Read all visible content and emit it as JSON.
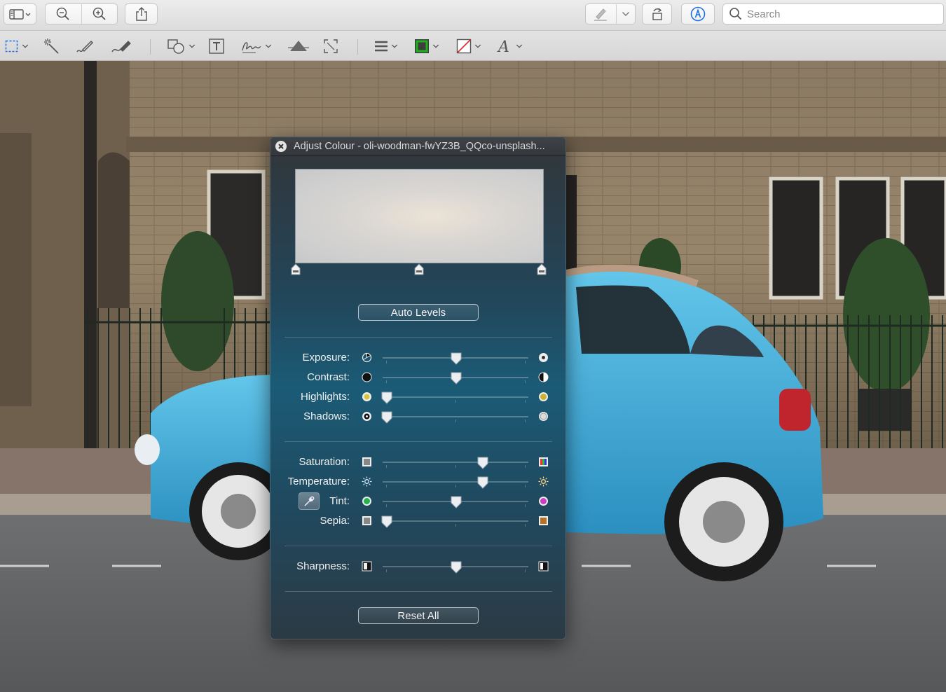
{
  "toolbar": {
    "search_placeholder": "Search",
    "icons": [
      "sidebar-icon",
      "zoom-out-icon",
      "zoom-in-icon",
      "share-icon",
      "highlight-pen-icon",
      "rotate-icon",
      "markup-icon",
      "search-icon"
    ]
  },
  "markup_toolbar": {
    "icons": [
      "rectangular-selection-icon",
      "instant-alpha-icon",
      "sketch-icon",
      "draw-icon",
      "shapes-icon",
      "text-icon",
      "sign-icon",
      "adjust-colour-icon",
      "adjust-size-icon",
      "line-style-icon",
      "border-colour-icon",
      "fill-colour-icon",
      "text-style-icon"
    ],
    "border_colour": "#1db11d",
    "fill_colour": "none"
  },
  "panel": {
    "title": "Adjust Colour - oli-woodman-fwYZ3B_QQco-unsplash...",
    "auto_levels_label": "Auto Levels",
    "reset_all_label": "Reset All",
    "levels": {
      "black_point": 0,
      "midpoint": 0.5,
      "white_point": 1
    },
    "sliders": [
      {
        "label": "Exposure:",
        "value": 0.5
      },
      {
        "label": "Contrast:",
        "value": 0.5
      },
      {
        "label": "Highlights:",
        "value": 0.0
      },
      {
        "label": "Shadows:",
        "value": 0.0
      },
      {
        "label": "Saturation:",
        "value": 0.69
      },
      {
        "label": "Temperature:",
        "value": 0.69
      },
      {
        "label": "Tint:",
        "value": 0.5
      },
      {
        "label": "Sepia:",
        "value": 0.0
      },
      {
        "label": "Sharpness:",
        "value": 0.5
      }
    ]
  }
}
